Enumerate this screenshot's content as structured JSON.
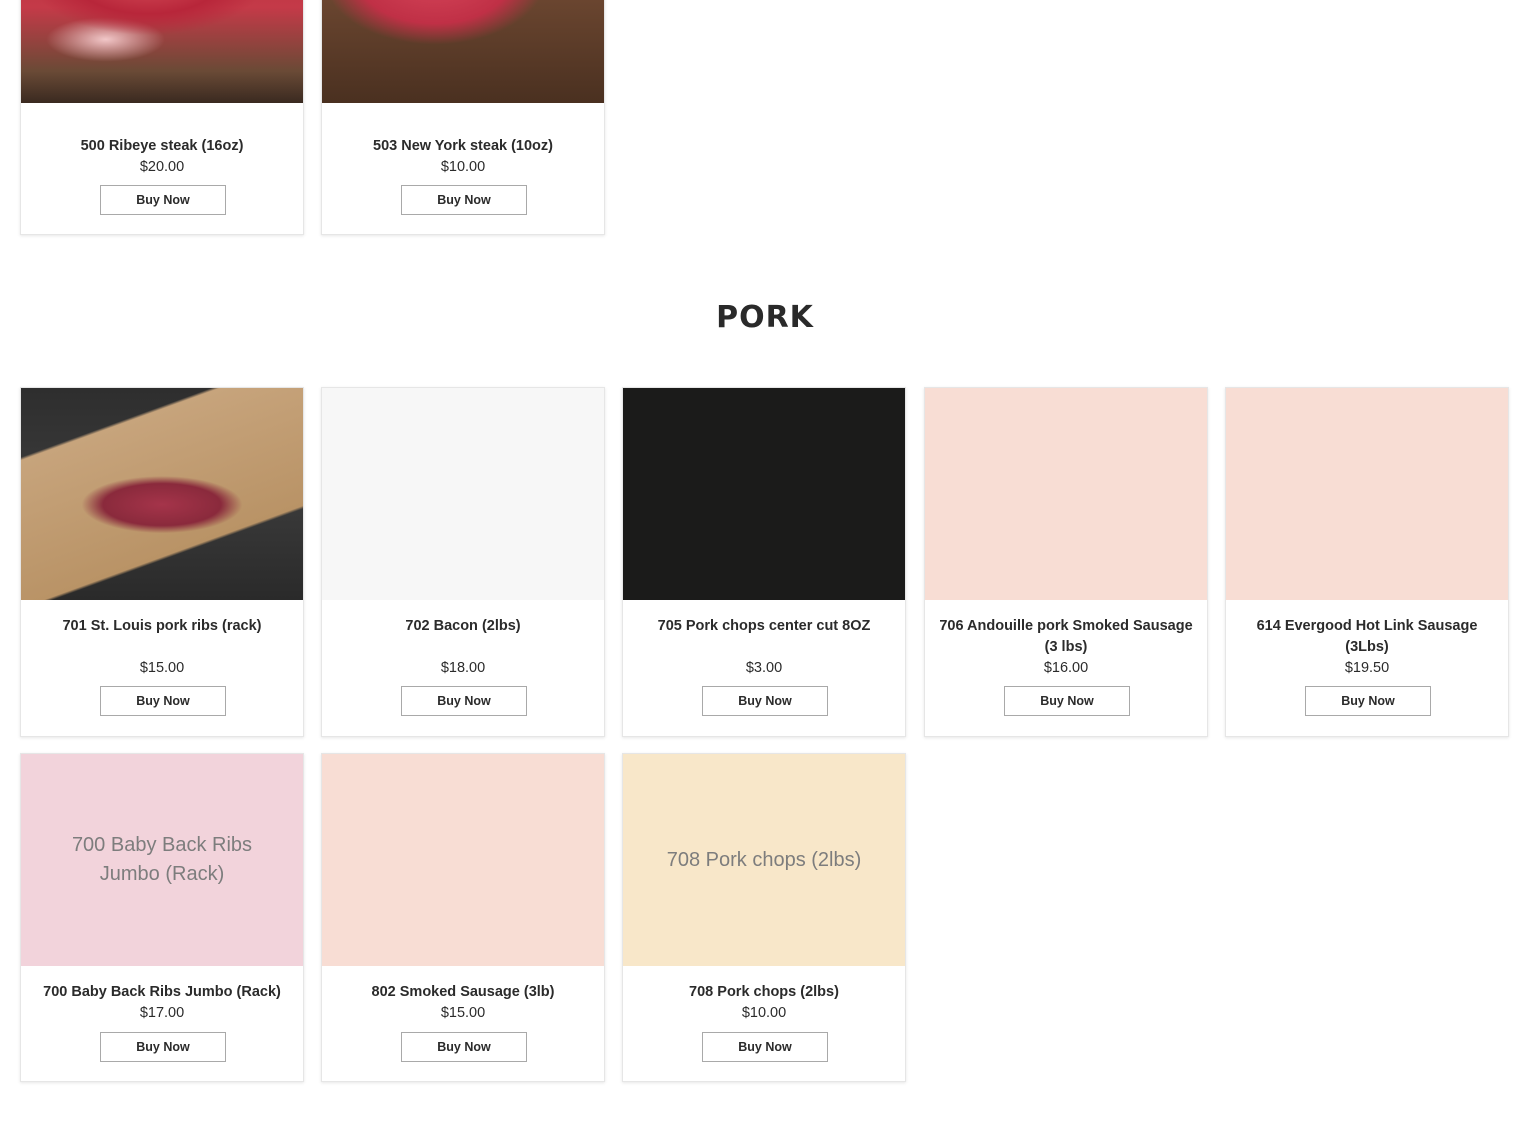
{
  "colors": {
    "placeholder_light": "#f7f7f7",
    "placeholder_black": "#1b1b1a",
    "placeholder_peach": "#f8ddd4",
    "placeholder_pink": "#f2d3db",
    "placeholder_cream": "#f8e7c9"
  },
  "beef_products": [
    {
      "name": "500 Ribeye steak (16oz)",
      "price": "$20.00",
      "button": "Buy Now"
    },
    {
      "name": "503 New York steak (10oz)",
      "price": "$10.00",
      "button": "Buy Now"
    }
  ],
  "pork": {
    "title": "PORK",
    "products": [
      {
        "name": "701 St. Louis pork ribs (rack)",
        "price": "$15.00",
        "button": "Buy Now"
      },
      {
        "name": "702 Bacon (2lbs)",
        "price": "$18.00",
        "button": "Buy Now"
      },
      {
        "name": "705 Pork chops center cut 8OZ",
        "price": "$3.00",
        "button": "Buy Now"
      },
      {
        "name": "706 Andouille pork Smoked Sausage (3 lbs)",
        "price": "$16.00",
        "button": "Buy Now"
      },
      {
        "name": "614 Evergood Hot Link Sausage (3Lbs)",
        "price": "$19.50",
        "button": "Buy Now"
      },
      {
        "name": "700 Baby Back Ribs Jumbo (Rack)",
        "image_text": "700 Baby Back Ribs Jumbo (Rack)",
        "price": "$17.00",
        "button": "Buy Now"
      },
      {
        "name": "802 Smoked Sausage (3lb)",
        "price": "$15.00",
        "button": "Buy Now"
      },
      {
        "name": "708 Pork chops (2lbs)",
        "image_text": "708 Pork chops (2lbs)",
        "price": "$10.00",
        "button": "Buy Now"
      }
    ]
  }
}
